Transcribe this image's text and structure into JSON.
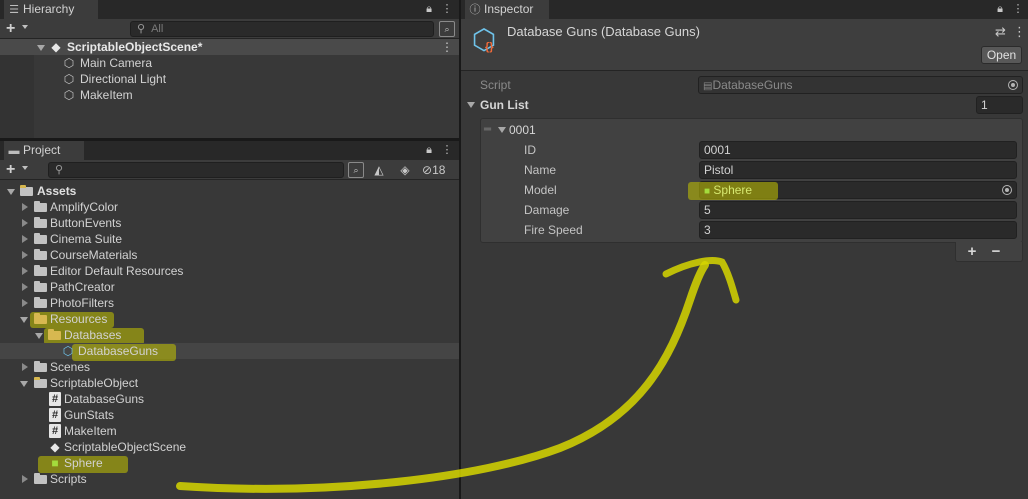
{
  "hierarchy": {
    "tab_label": "Hierarchy",
    "search_placeholder": "All",
    "scene_name": "ScriptableObjectScene*",
    "items": [
      "Main Camera",
      "Directional Light",
      "MakeItem"
    ]
  },
  "project": {
    "tab_label": "Project",
    "hidden_count": "18",
    "tree": {
      "assets": "Assets",
      "folders_top": [
        "AmplifyColor",
        "ButtonEvents",
        "Cinema Suite",
        "CourseMaterials",
        "Editor Default Resources",
        "PathCreator",
        "PhotoFilters"
      ],
      "resources": "Resources",
      "databases": "Databases",
      "database_guns": "DatabaseGuns",
      "scenes": "Scenes",
      "scriptable_object": "ScriptableObject",
      "so_children": [
        "DatabaseGuns",
        "GunStats",
        "MakeItem",
        "ScriptableObjectScene",
        "Sphere"
      ],
      "scripts": "Scripts"
    }
  },
  "inspector": {
    "tab_label": "Inspector",
    "title": "Database Guns (Database Guns)",
    "open_label": "Open",
    "script_label": "Script",
    "script_value": "DatabaseGuns",
    "gun_list_label": "Gun List",
    "gun_list_size": "1",
    "element_label": "0001",
    "fields": {
      "id_label": "ID",
      "id_value": "0001",
      "name_label": "Name",
      "name_value": "Pistol",
      "model_label": "Model",
      "model_value": "Sphere",
      "damage_label": "Damage",
      "damage_value": "5",
      "fire_speed_label": "Fire Speed",
      "fire_speed_value": "3"
    },
    "add_label": "+",
    "remove_label": "−"
  },
  "icons": {
    "hierarchy_tab": "list-icon",
    "project_tab": "folder-icon",
    "inspector_tab": "info-icon",
    "lock": "lock-icon",
    "menu": "kebab-menu-icon",
    "search": "search-icon",
    "unity_scene": "unity-logo-icon",
    "gameobject": "cube-outline-icon",
    "script": "hash-script-icon",
    "prefab": "green-cube-icon",
    "scriptable_asset": "scriptable-object-icon"
  },
  "colors": {
    "highlight": "#c4c400",
    "selection": "#2c5d87",
    "sphere_green": "#a4dc3c",
    "folder_yellow": "#d7b850"
  }
}
